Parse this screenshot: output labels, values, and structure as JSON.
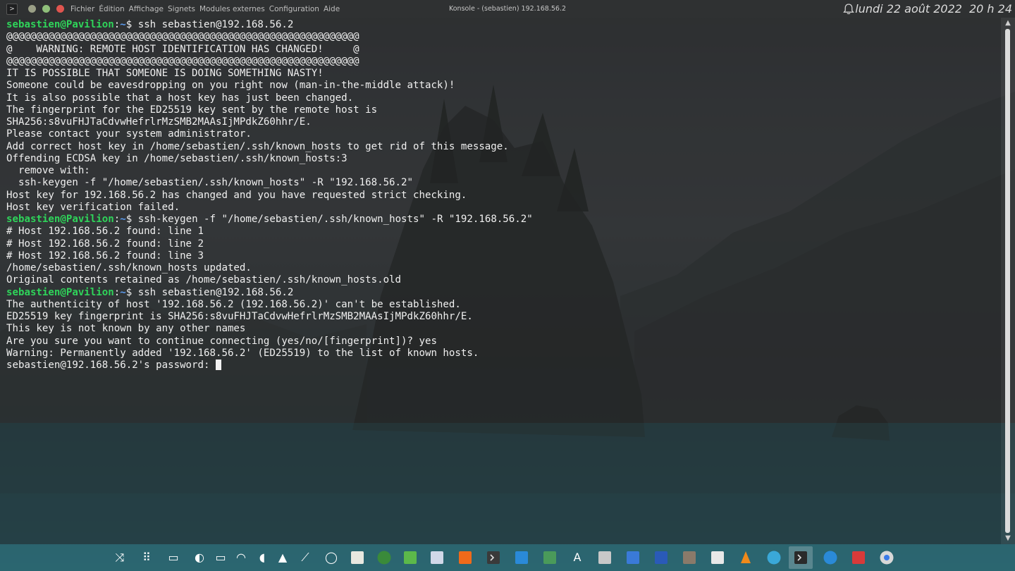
{
  "window": {
    "title": "Konsole - (sebastien) 192.168.56.2"
  },
  "menu": {
    "items": [
      "Fichier",
      "Édition",
      "Affichage",
      "Signets",
      "Modules externes",
      "Configuration",
      "Aide"
    ]
  },
  "clock": {
    "date": "lundi 22 août 2022",
    "time": "20 h 24"
  },
  "terminal": {
    "prompt_user": "sebastien@Pavilion",
    "prompt_path": "~",
    "lines": [
      {
        "type": "prompt",
        "command": "ssh sebastien@192.168.56.2"
      },
      {
        "type": "out",
        "text": "@@@@@@@@@@@@@@@@@@@@@@@@@@@@@@@@@@@@@@@@@@@@@@@@@@@@@@@@@@@"
      },
      {
        "type": "out",
        "text": "@    WARNING: REMOTE HOST IDENTIFICATION HAS CHANGED!     @"
      },
      {
        "type": "out",
        "text": "@@@@@@@@@@@@@@@@@@@@@@@@@@@@@@@@@@@@@@@@@@@@@@@@@@@@@@@@@@@"
      },
      {
        "type": "out",
        "text": "IT IS POSSIBLE THAT SOMEONE IS DOING SOMETHING NASTY!"
      },
      {
        "type": "out",
        "text": "Someone could be eavesdropping on you right now (man-in-the-middle attack)!"
      },
      {
        "type": "out",
        "text": "It is also possible that a host key has just been changed."
      },
      {
        "type": "out",
        "text": "The fingerprint for the ED25519 key sent by the remote host is"
      },
      {
        "type": "out",
        "text": "SHA256:s8vuFHJTaCdvwHefrlrMzSMB2MAAsIjMPdkZ60hhr/E."
      },
      {
        "type": "out",
        "text": "Please contact your system administrator."
      },
      {
        "type": "out",
        "text": "Add correct host key in /home/sebastien/.ssh/known_hosts to get rid of this message."
      },
      {
        "type": "out",
        "text": "Offending ECDSA key in /home/sebastien/.ssh/known_hosts:3"
      },
      {
        "type": "out",
        "text": "  remove with:"
      },
      {
        "type": "out",
        "text": "  ssh-keygen -f \"/home/sebastien/.ssh/known_hosts\" -R \"192.168.56.2\""
      },
      {
        "type": "out",
        "text": "Host key for 192.168.56.2 has changed and you have requested strict checking."
      },
      {
        "type": "out",
        "text": "Host key verification failed."
      },
      {
        "type": "prompt",
        "command": "ssh-keygen -f \"/home/sebastien/.ssh/known_hosts\" -R \"192.168.56.2\""
      },
      {
        "type": "out",
        "text": "# Host 192.168.56.2 found: line 1"
      },
      {
        "type": "out",
        "text": "# Host 192.168.56.2 found: line 2"
      },
      {
        "type": "out",
        "text": "# Host 192.168.56.2 found: line 3"
      },
      {
        "type": "out",
        "text": "/home/sebastien/.ssh/known_hosts updated."
      },
      {
        "type": "out",
        "text": "Original contents retained as /home/sebastien/.ssh/known_hosts.old"
      },
      {
        "type": "prompt",
        "command": "ssh sebastien@192.168.56.2"
      },
      {
        "type": "out",
        "text": "The authenticity of host '192.168.56.2 (192.168.56.2)' can't be established."
      },
      {
        "type": "out",
        "text": "ED25519 key fingerprint is SHA256:s8vuFHJTaCdvwHefrlrMzSMB2MAAsIjMPdkZ60hhr/E."
      },
      {
        "type": "out",
        "text": "This key is not known by any other names"
      },
      {
        "type": "out",
        "text": "Are you sure you want to continue connecting (yes/no/[fingerprint])? yes"
      },
      {
        "type": "out",
        "text": "Warning: Permanently added '192.168.56.2' (ED25519) to the list of known hosts."
      },
      {
        "type": "input",
        "text": "sebastien@192.168.56.2's password: "
      }
    ]
  },
  "dock": {
    "items": [
      {
        "icon": "kde-connect-icon",
        "color": "#ffffff"
      },
      {
        "icon": "app-grid-icon",
        "color": "#ffffff"
      },
      {
        "icon": "show-desktop-icon",
        "color": "#ffffff"
      },
      {
        "icon": "bulb-icon",
        "color": "#ffffff"
      },
      {
        "icon": "battery-icon",
        "color": "#ffffff"
      },
      {
        "icon": "wifi-icon",
        "color": "#ffffff"
      },
      {
        "icon": "volume-icon",
        "color": "#ffffff"
      },
      {
        "icon": "tray-expand-icon",
        "color": "#ffffff"
      },
      {
        "icon": "color-picker-icon",
        "color": "#ffffff"
      },
      {
        "icon": "circle-launcher-icon",
        "color": "#ffffff"
      },
      {
        "icon": "notes-icon",
        "color": "#e8e8e0"
      },
      {
        "icon": "globe-app-icon",
        "color": "#3a8a3a"
      },
      {
        "icon": "green-app-icon",
        "color": "#5cb84a"
      },
      {
        "icon": "virtualbox-icon",
        "color": "#d0d8e8"
      },
      {
        "icon": "orange-app-icon",
        "color": "#f06a1a"
      },
      {
        "icon": "dark-terminal-app-icon",
        "color": "#3a3a3a"
      },
      {
        "icon": "blue-folder-icon",
        "color": "#2a8ad8"
      },
      {
        "icon": "system-monitor-icon",
        "color": "#4a9a5a"
      },
      {
        "icon": "font-app-icon",
        "color": "#ffffff"
      },
      {
        "icon": "calculator-icon",
        "color": "#c8c8c8"
      },
      {
        "icon": "blue-tool-icon",
        "color": "#3a7ad8"
      },
      {
        "icon": "word-processor-icon",
        "color": "#2a5ab8"
      },
      {
        "icon": "gimp-icon",
        "color": "#8a7a6a"
      },
      {
        "icon": "inkscape-icon",
        "color": "#e8e8e8"
      },
      {
        "icon": "vlc-icon",
        "color": "#f08a1a"
      },
      {
        "icon": "mail-icon",
        "color": "#3aa8d8"
      },
      {
        "icon": "konsole-icon",
        "color": "#2a2a2a"
      },
      {
        "icon": "network-app-icon",
        "color": "#2a8ad8"
      },
      {
        "icon": "red-folder-icon",
        "color": "#d83a3a"
      },
      {
        "icon": "chrome-icon",
        "color": "#d8d8d8"
      }
    ]
  }
}
